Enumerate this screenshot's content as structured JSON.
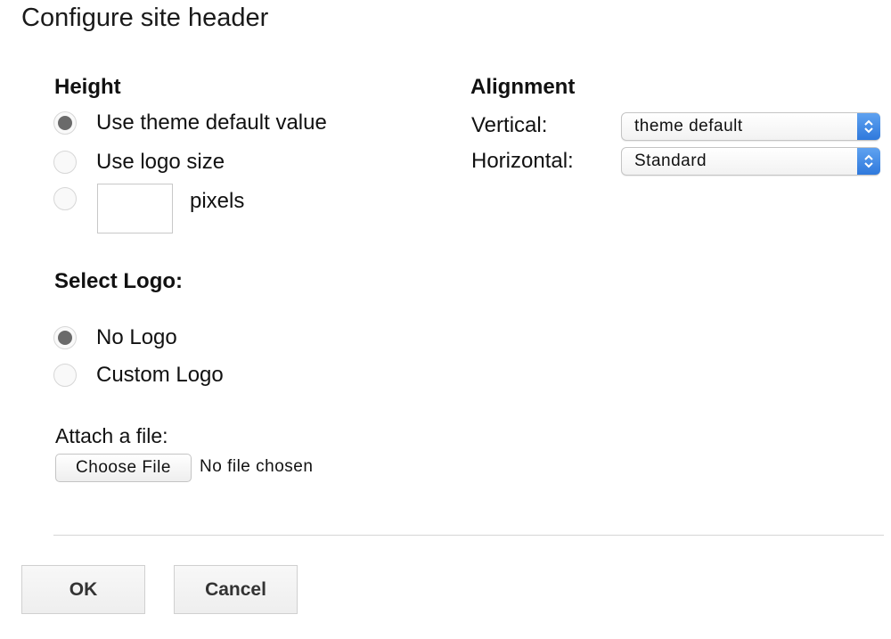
{
  "dialog": {
    "title": "Configure site header"
  },
  "height": {
    "heading": "Height",
    "options": [
      {
        "label": "Use theme default value",
        "checked": true
      },
      {
        "label": "Use logo size",
        "checked": false
      },
      {
        "label": "",
        "checked": false
      }
    ],
    "pixels_value": "",
    "pixels_unit": "pixels"
  },
  "alignment": {
    "heading": "Alignment",
    "vertical_label": "Vertical:",
    "vertical_value": "theme default",
    "horizontal_label": "Horizontal:",
    "horizontal_value": "Standard",
    "accent_color": "#3b82e0"
  },
  "logo": {
    "heading": "Select Logo:",
    "options": [
      {
        "label": "No Logo",
        "checked": true
      },
      {
        "label": "Custom Logo",
        "checked": false
      }
    ]
  },
  "attach": {
    "label": "Attach a file:",
    "button_label": "Choose File",
    "status": "No file chosen"
  },
  "footer": {
    "ok_label": "OK",
    "cancel_label": "Cancel"
  }
}
